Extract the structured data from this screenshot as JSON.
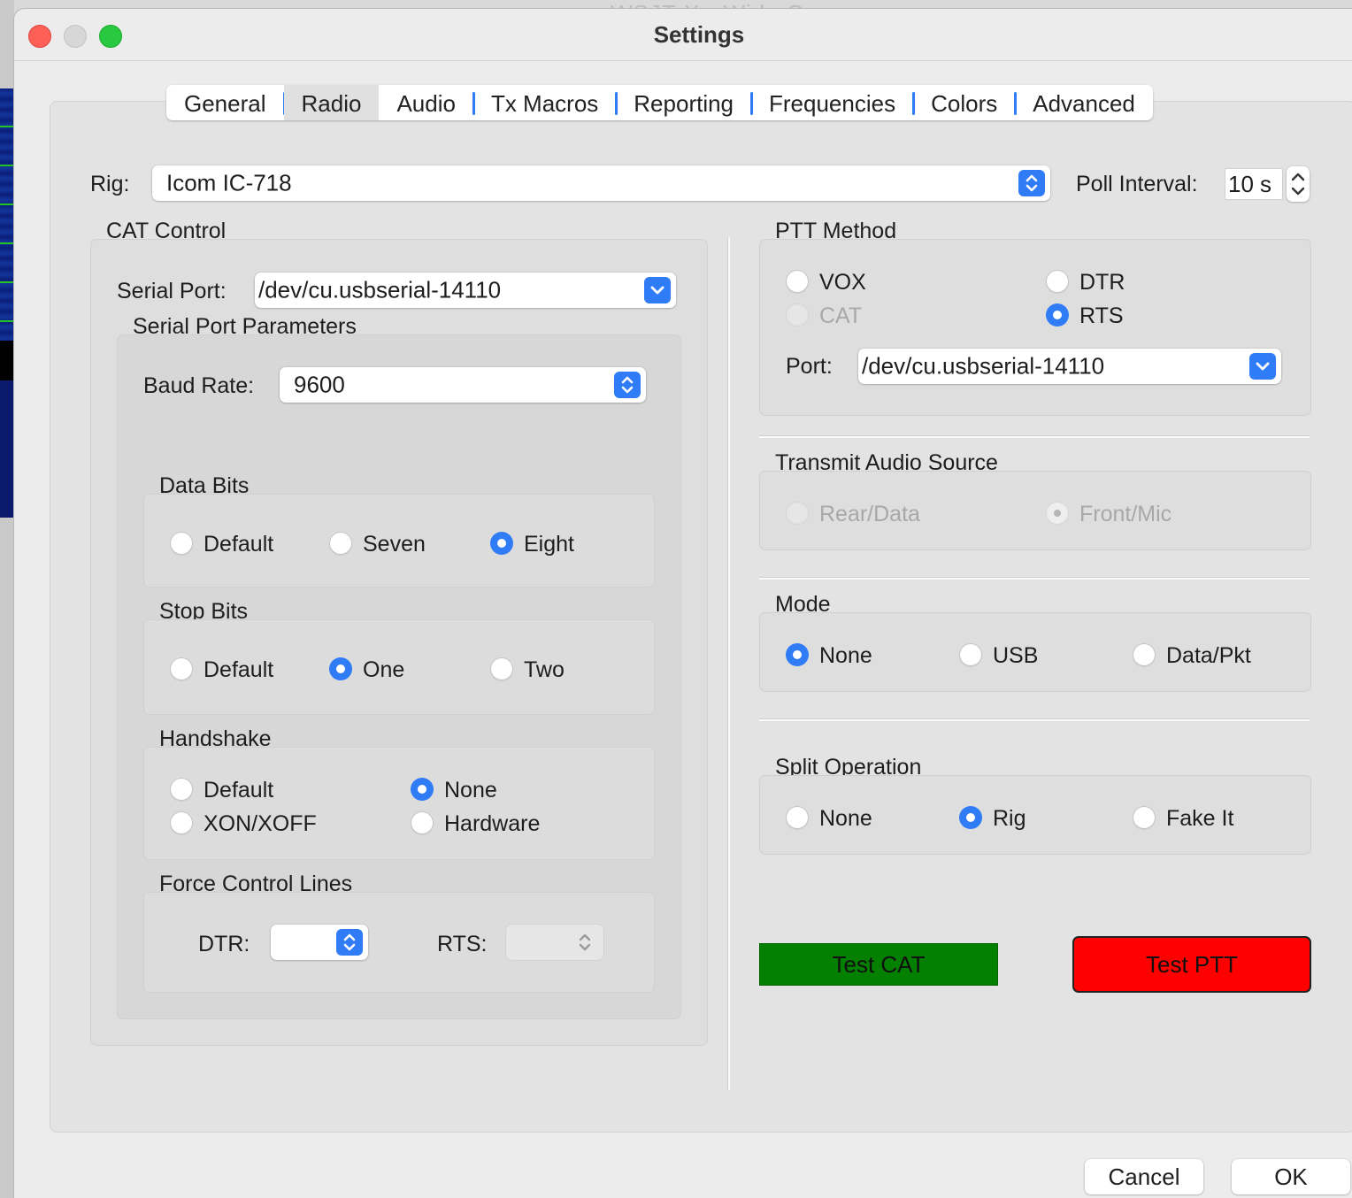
{
  "window": {
    "title": "Settings",
    "background_title": "WSJT-X - Wide G"
  },
  "tabs": [
    {
      "label": "General"
    },
    {
      "label": "Radio"
    },
    {
      "label": "Audio"
    },
    {
      "label": "Tx Macros"
    },
    {
      "label": "Reporting"
    },
    {
      "label": "Frequencies"
    },
    {
      "label": "Colors"
    },
    {
      "label": "Advanced"
    }
  ],
  "active_tab": "Radio",
  "rig": {
    "label": "Rig:",
    "value": "Icom IC-718"
  },
  "poll": {
    "label": "Poll Interval:",
    "value": "10",
    "unit": "s"
  },
  "cat": {
    "title": "CAT Control",
    "serial_port_label": "Serial Port:",
    "serial_port_value": "/dev/cu.usbserial-14110",
    "params_title": "Serial Port Parameters",
    "baud_label": "Baud Rate:",
    "baud_value": "9600",
    "data_bits": {
      "title": "Data Bits",
      "options": [
        "Default",
        "Seven",
        "Eight"
      ],
      "selected": "Eight"
    },
    "stop_bits": {
      "title": "Stop Bits",
      "options": [
        "Default",
        "One",
        "Two"
      ],
      "selected": "One"
    },
    "handshake": {
      "title": "Handshake",
      "options": [
        "Default",
        "None",
        "XON/XOFF",
        "Hardware"
      ],
      "selected": "None"
    },
    "force": {
      "title": "Force Control Lines",
      "dtr_label": "DTR:",
      "rts_label": "RTS:"
    }
  },
  "ptt": {
    "title": "PTT Method",
    "options": [
      "VOX",
      "DTR",
      "CAT",
      "RTS"
    ],
    "selected": "RTS",
    "disabled": [
      "CAT"
    ],
    "port_label": "Port:",
    "port_value": "/dev/cu.usbserial-14110"
  },
  "tx_audio": {
    "title": "Transmit Audio Source",
    "options": [
      "Rear/Data",
      "Front/Mic"
    ],
    "selected": "Front/Mic",
    "disabled": true
  },
  "mode": {
    "title": "Mode",
    "options": [
      "None",
      "USB",
      "Data/Pkt"
    ],
    "selected": "None"
  },
  "split": {
    "title": "Split Operation",
    "options": [
      "None",
      "Rig",
      "Fake It"
    ],
    "selected": "Rig"
  },
  "buttons": {
    "test_cat": "Test CAT",
    "test_ptt": "Test PTT",
    "cancel": "Cancel",
    "ok": "OK"
  },
  "colors": {
    "accent": "#2f7cf6",
    "test_cat_bg": "#048000",
    "test_ptt_bg": "#ff0000"
  }
}
